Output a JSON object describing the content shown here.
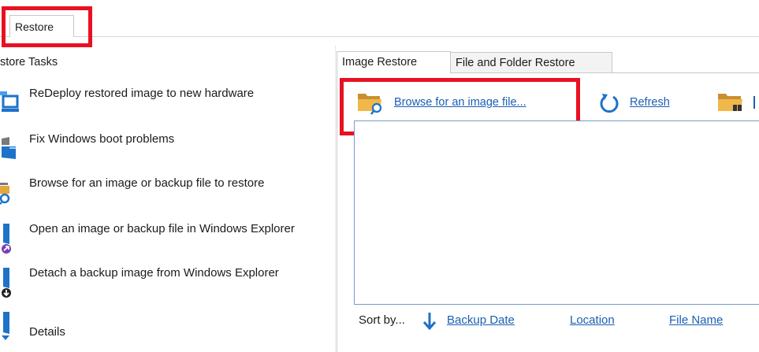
{
  "top_tab": {
    "label": "Restore"
  },
  "left": {
    "title": "store Tasks",
    "tasks": [
      {
        "label": "ReDeploy restored image to new hardware"
      },
      {
        "label": "Fix Windows boot problems"
      },
      {
        "label": "Browse for an image or backup file to restore"
      },
      {
        "label": "Open an image or backup file in Windows Explorer"
      },
      {
        "label": "Detach a backup image from Windows Explorer"
      },
      {
        "label": "Details"
      }
    ]
  },
  "right": {
    "tabs": [
      {
        "label": "Image Restore"
      },
      {
        "label": "File and Folder Restore"
      }
    ],
    "toolbar": {
      "browse": "Browse for an image file...",
      "refresh": "Refresh"
    },
    "sort": {
      "label": "Sort by...",
      "options": [
        "Backup Date",
        "Location",
        "File Name"
      ]
    }
  },
  "colors": {
    "highlight": "#e81123",
    "link": "#1a5fb4",
    "icon_blue": "#1e72c8",
    "folder": "#e3a83b"
  }
}
